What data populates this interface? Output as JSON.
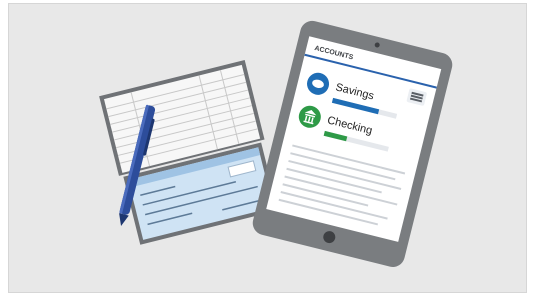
{
  "illustration": {
    "colors": {
      "background": "#e8e8e8",
      "tablet_body": "#7a7d80",
      "tablet_screen": "#ffffff",
      "savings_accent": "#1f6db5",
      "checking_accent": "#2e9a47",
      "pen": "#2d4d9b",
      "check_paper": "#cfe3f4",
      "ledger_paper": "#f7f7f7"
    },
    "tablet": {
      "header_label": "ACCOUNTS",
      "menu_icon": "hamburger-icon",
      "accounts": [
        {
          "label": "Savings",
          "icon": "piggy-bank-icon",
          "progress": 0.72
        },
        {
          "label": "Checking",
          "icon": "bank-building-icon",
          "progress": 0.35
        }
      ]
    },
    "checkbook": {
      "icon": "checkbook-icon"
    },
    "pen": {
      "icon": "pen-icon"
    }
  }
}
